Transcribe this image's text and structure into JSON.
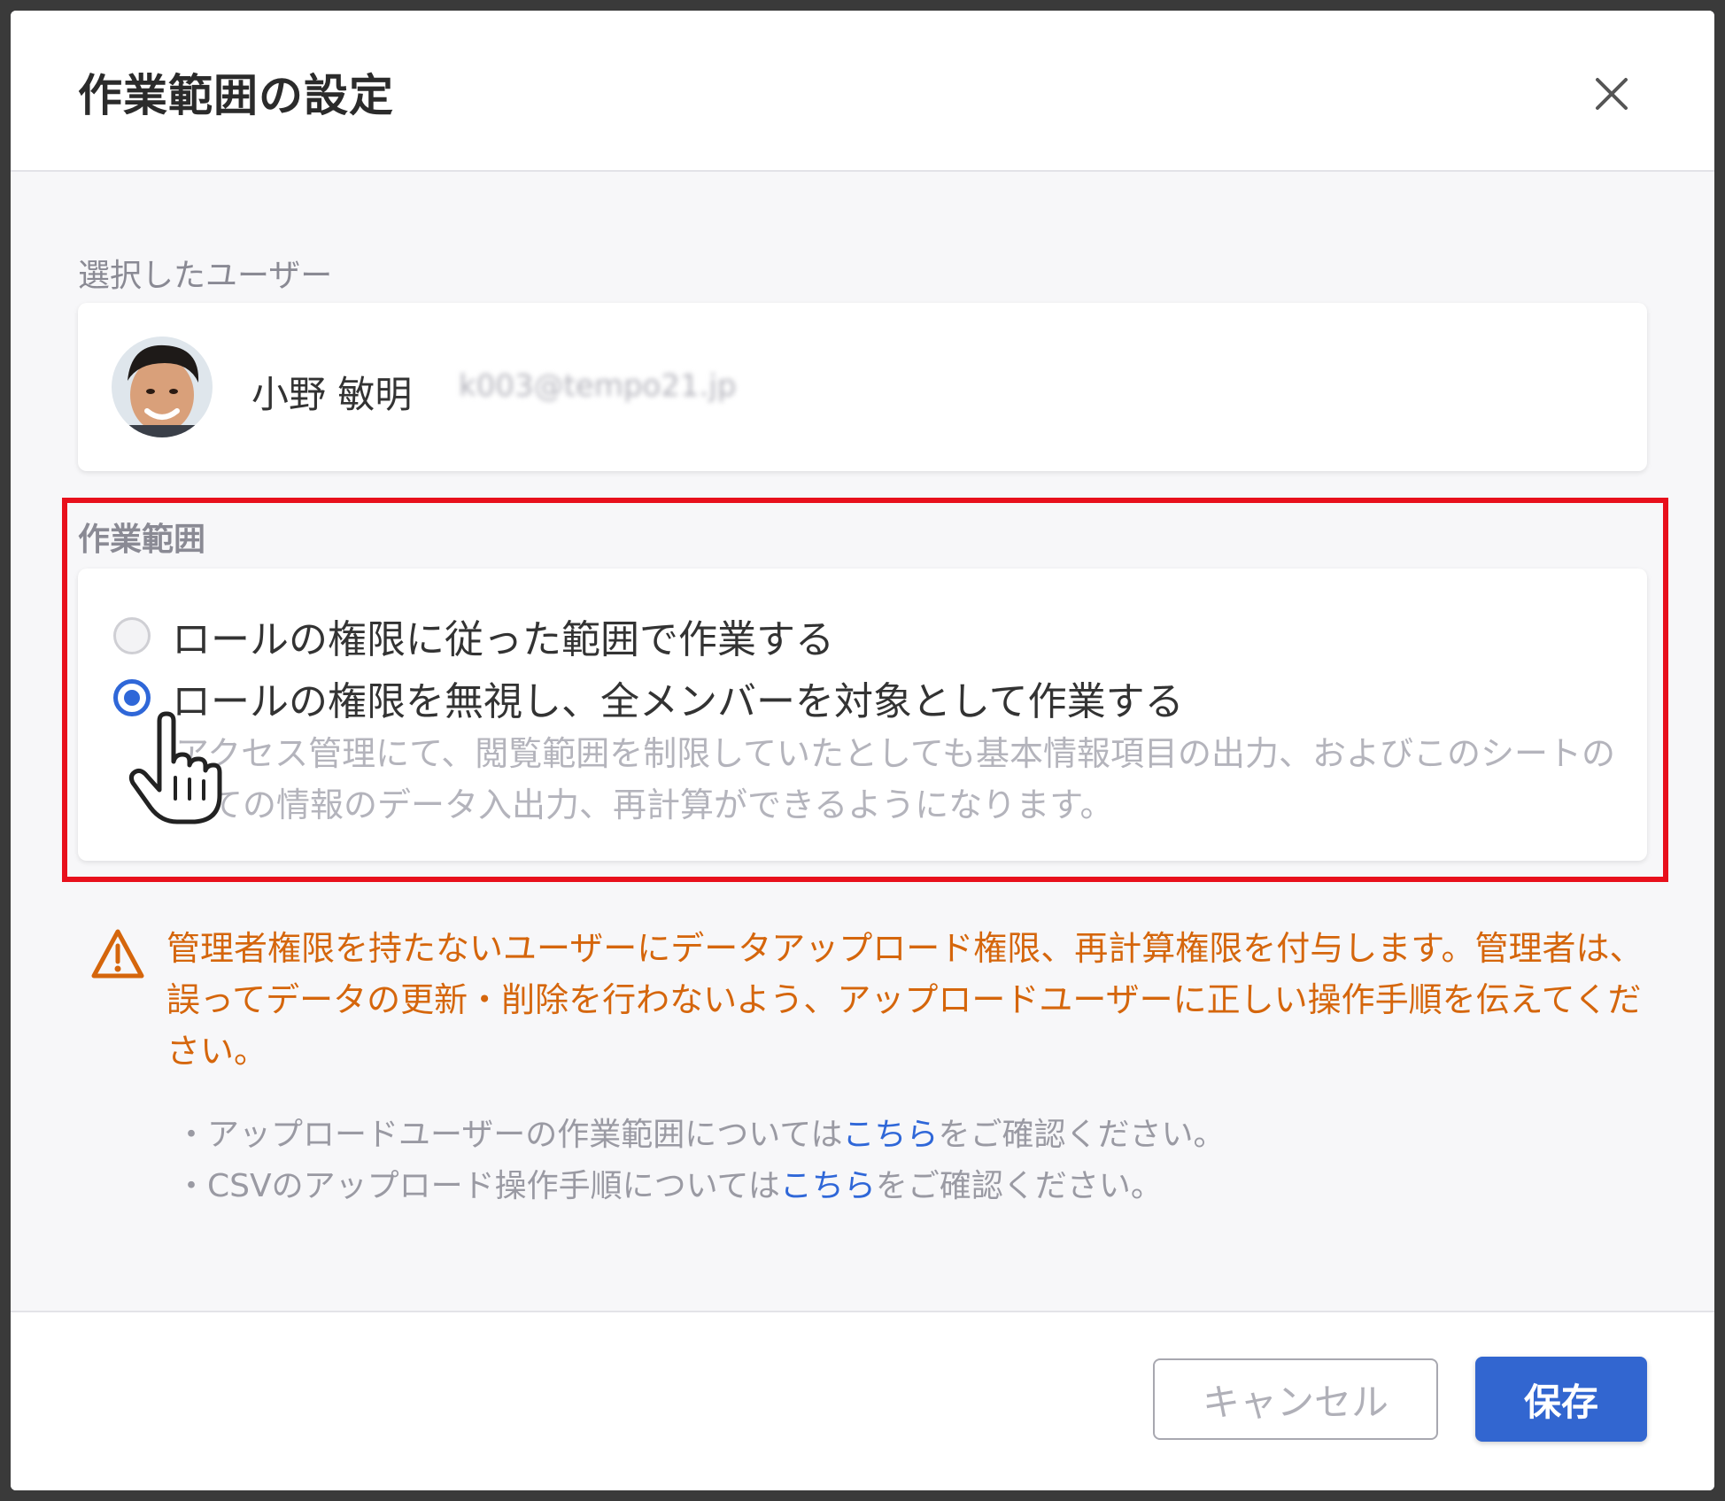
{
  "dialog": {
    "title": "作業範囲の設定"
  },
  "user_section": {
    "label": "選択したユーザー",
    "name": "小野 敏明",
    "email": "k003@tempo21.jp"
  },
  "scope_section": {
    "label": "作業範囲",
    "options": [
      {
        "label": "ロールの権限に従った範囲で作業する",
        "selected": false
      },
      {
        "label": "ロールの権限を無視し、全メンバーを対象として作業する",
        "selected": true
      }
    ],
    "description": "アクセス管理にて、閲覧範囲を制限していたとしても基本情報項目の出力、およびこのシートの全ての情報のデータ入出力、再計算ができるようになります。"
  },
  "warning": {
    "text": "管理者権限を持たないユーザーにデータアップロード権限、再計算権限を付与します。管理者は、誤ってデータの更新・削除を行わないよう、アップロードユーザーに正しい操作手順を伝えてください。",
    "color": "#d5660c"
  },
  "notes": [
    {
      "prefix": "・アップロードユーザーの作業範囲については",
      "link": "こちら",
      "suffix": "をご確認ください。"
    },
    {
      "prefix": "・CSVのアップロード操作手順については",
      "link": "こちら",
      "suffix": "をご確認ください。"
    }
  ],
  "footer": {
    "cancel_label": "キャンセル",
    "save_label": "保存"
  },
  "colors": {
    "accent": "#3266d0",
    "highlight_frame": "#e8101c"
  },
  "icons": [
    "close-icon",
    "warning-icon",
    "hand-pointer-icon"
  ]
}
